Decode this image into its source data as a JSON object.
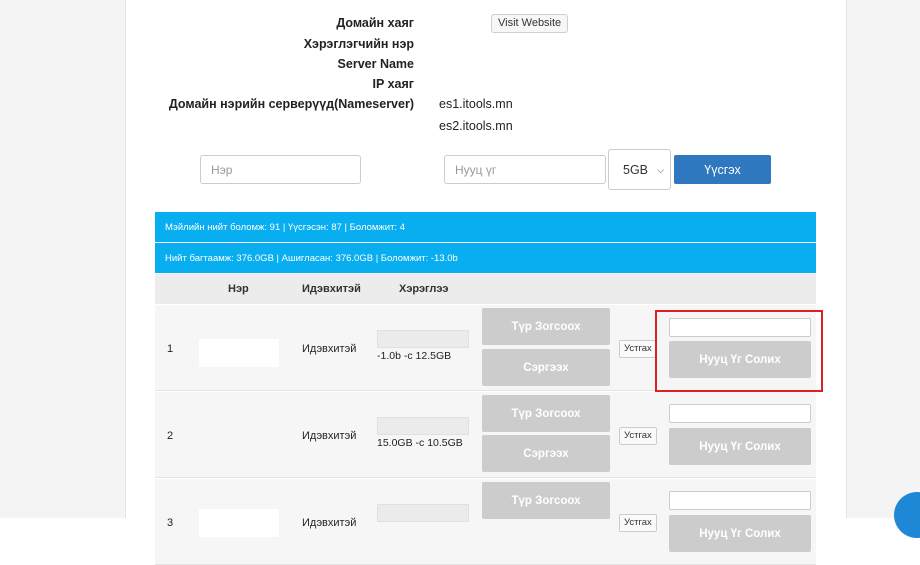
{
  "domain_info": {
    "domain_label": "Домайн хаяг",
    "visit_button": "Visit Website",
    "username_label": "Хэрэглэгчийн нэр",
    "server_label": "Server Name",
    "ip_label": "IP хаяг",
    "nameserver_label": "Домайн нэрийн серверүүд(Nameserver)",
    "nameservers": [
      "es1.itools.mn",
      "es2.itools.mn"
    ]
  },
  "create_form": {
    "name_placeholder": "Нэр",
    "password_placeholder": "Нууц үг",
    "size_selected": "5GB",
    "create_button": "Үүсгэх"
  },
  "stats": {
    "mail_line": "Мэйлийн нийт боломж: 91 | Үүсгэсэн: 87 | Боломжит: 4",
    "storage_line": "Нийт багтаамж: 376.0GB | Ашигласан: 376.0GB | Боломжит: -13.0b"
  },
  "table": {
    "headers": {
      "name": "Нэр",
      "status": "Идэвхитэй",
      "usage": "Хэрэглээ"
    },
    "suspend_label": "Түр Зогсоох",
    "restore_label": "Сэргээх",
    "remove_label": "Устгах",
    "change_password_label": "Нууц Үг Солих",
    "rows": [
      {
        "num": "1",
        "status": "Идэвхитэй",
        "usage": "-1.0b -с 12.5GB"
      },
      {
        "num": "2",
        "status": "Идэвхитэй",
        "usage": "15.0GB -с 10.5GB"
      },
      {
        "num": "3",
        "status": "Идэвхитэй",
        "usage": ""
      }
    ]
  },
  "colors": {
    "accent_blue": "#08aef0",
    "button_blue": "#2f78bf",
    "highlight_red": "#dd1f26"
  }
}
